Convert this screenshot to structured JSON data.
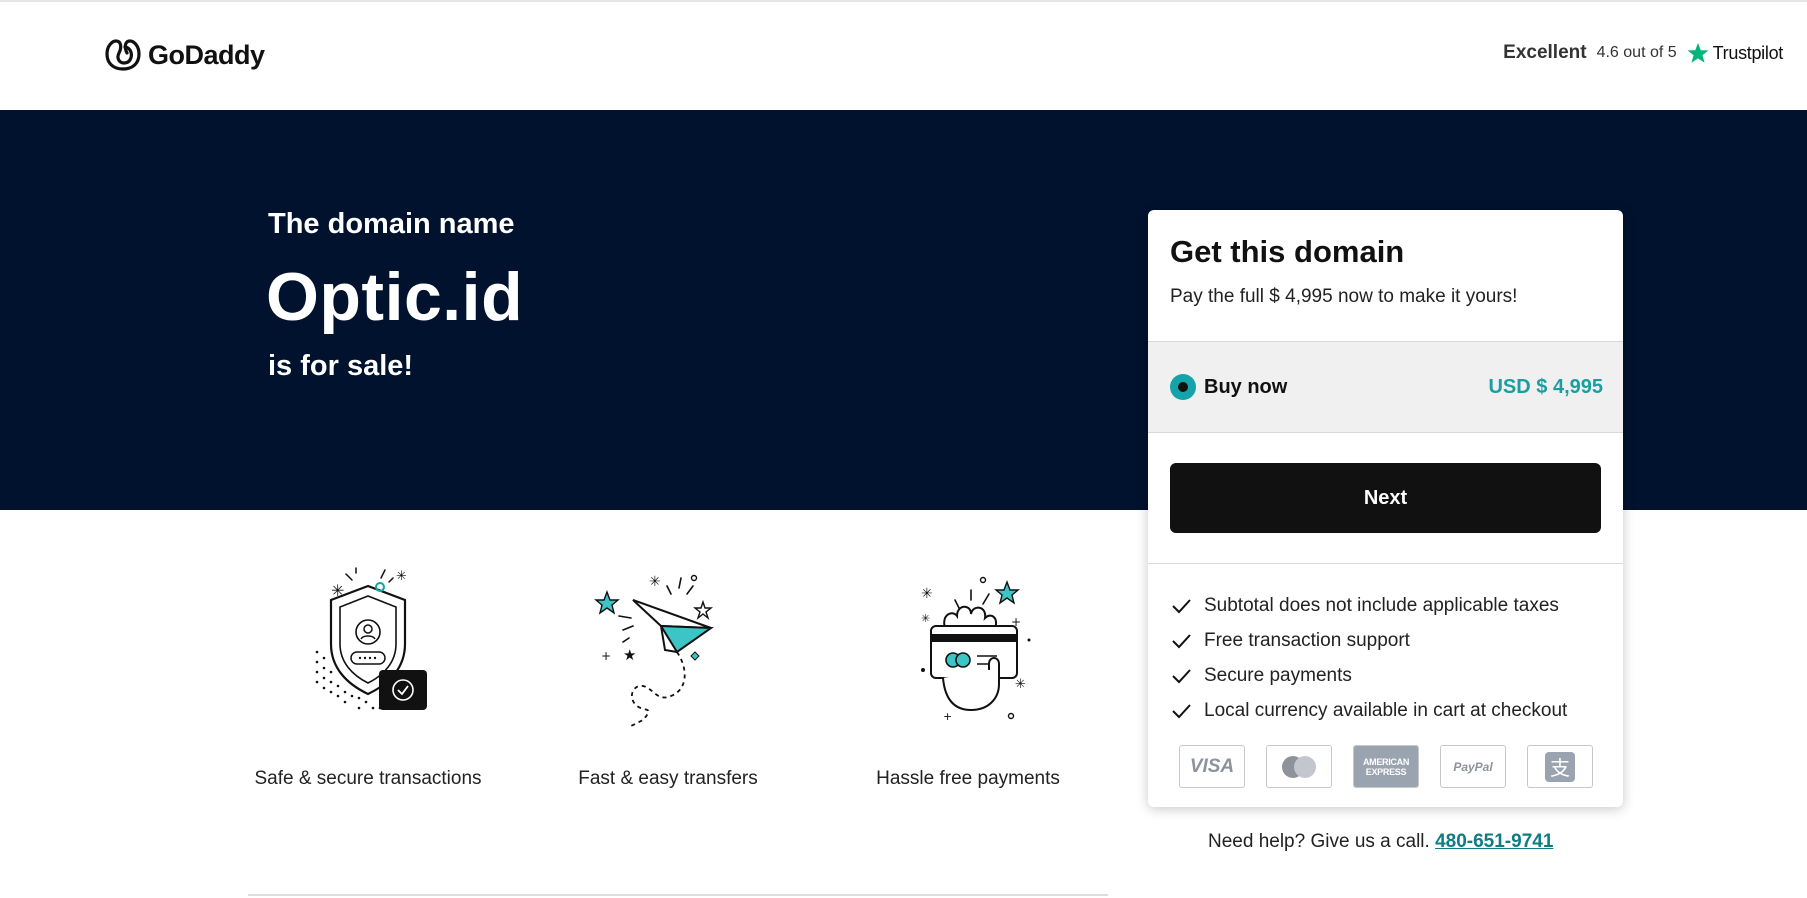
{
  "header": {
    "logo_text": "GoDaddy",
    "trustpilot": {
      "rating_word": "Excellent",
      "score_text": "4.6 out of 5",
      "brand": "Trustpilot",
      "star_color": "#00b67a"
    }
  },
  "hero": {
    "pre_text": "The domain name",
    "domain": "Optic.id",
    "post_text": "is for sale!",
    "background": "#00122e"
  },
  "features": [
    {
      "label": "Safe & secure transactions",
      "icon": "shield-icon"
    },
    {
      "label": "Fast & easy transfers",
      "icon": "paper-plane-icon"
    },
    {
      "label": "Hassle free payments",
      "icon": "hand-card-icon"
    }
  ],
  "card": {
    "title": "Get this domain",
    "subtitle": "Pay the full $ 4,995 now to make it yours!",
    "option": {
      "label": "Buy now",
      "price": "USD $ 4,995",
      "selected": true
    },
    "next_label": "Next",
    "benefits": [
      "Subtotal does not include applicable taxes",
      "Free transaction support",
      "Secure payments",
      "Local currency available in cart at checkout"
    ],
    "payment_methods": {
      "visa": "VISA",
      "amex": "AMERICAN EXPRESS",
      "paypal": "PayPal",
      "alipay_glyph": "支"
    }
  },
  "help": {
    "text": "Need help? Give us a call.",
    "phone": "480-651-9741"
  },
  "colors": {
    "accent": "#1b9ea1",
    "button": "#111111"
  }
}
